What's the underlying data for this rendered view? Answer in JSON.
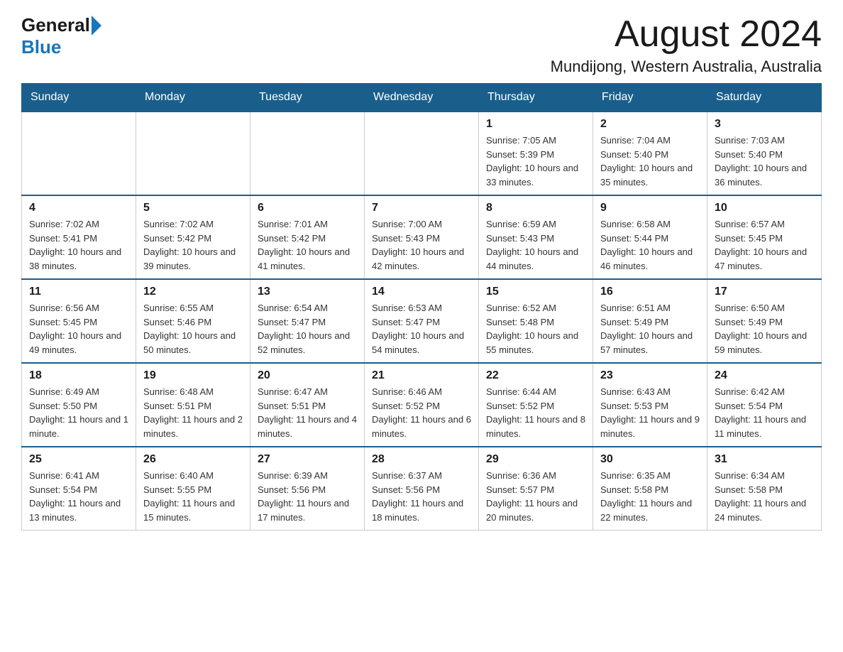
{
  "header": {
    "logo_general": "General",
    "logo_blue": "Blue",
    "month_title": "August 2024",
    "location": "Mundijong, Western Australia, Australia"
  },
  "weekdays": [
    "Sunday",
    "Monday",
    "Tuesday",
    "Wednesday",
    "Thursday",
    "Friday",
    "Saturday"
  ],
  "weeks": [
    [
      {
        "day": "",
        "info": ""
      },
      {
        "day": "",
        "info": ""
      },
      {
        "day": "",
        "info": ""
      },
      {
        "day": "",
        "info": ""
      },
      {
        "day": "1",
        "info": "Sunrise: 7:05 AM\nSunset: 5:39 PM\nDaylight: 10 hours and 33 minutes."
      },
      {
        "day": "2",
        "info": "Sunrise: 7:04 AM\nSunset: 5:40 PM\nDaylight: 10 hours and 35 minutes."
      },
      {
        "day": "3",
        "info": "Sunrise: 7:03 AM\nSunset: 5:40 PM\nDaylight: 10 hours and 36 minutes."
      }
    ],
    [
      {
        "day": "4",
        "info": "Sunrise: 7:02 AM\nSunset: 5:41 PM\nDaylight: 10 hours and 38 minutes."
      },
      {
        "day": "5",
        "info": "Sunrise: 7:02 AM\nSunset: 5:42 PM\nDaylight: 10 hours and 39 minutes."
      },
      {
        "day": "6",
        "info": "Sunrise: 7:01 AM\nSunset: 5:42 PM\nDaylight: 10 hours and 41 minutes."
      },
      {
        "day": "7",
        "info": "Sunrise: 7:00 AM\nSunset: 5:43 PM\nDaylight: 10 hours and 42 minutes."
      },
      {
        "day": "8",
        "info": "Sunrise: 6:59 AM\nSunset: 5:43 PM\nDaylight: 10 hours and 44 minutes."
      },
      {
        "day": "9",
        "info": "Sunrise: 6:58 AM\nSunset: 5:44 PM\nDaylight: 10 hours and 46 minutes."
      },
      {
        "day": "10",
        "info": "Sunrise: 6:57 AM\nSunset: 5:45 PM\nDaylight: 10 hours and 47 minutes."
      }
    ],
    [
      {
        "day": "11",
        "info": "Sunrise: 6:56 AM\nSunset: 5:45 PM\nDaylight: 10 hours and 49 minutes."
      },
      {
        "day": "12",
        "info": "Sunrise: 6:55 AM\nSunset: 5:46 PM\nDaylight: 10 hours and 50 minutes."
      },
      {
        "day": "13",
        "info": "Sunrise: 6:54 AM\nSunset: 5:47 PM\nDaylight: 10 hours and 52 minutes."
      },
      {
        "day": "14",
        "info": "Sunrise: 6:53 AM\nSunset: 5:47 PM\nDaylight: 10 hours and 54 minutes."
      },
      {
        "day": "15",
        "info": "Sunrise: 6:52 AM\nSunset: 5:48 PM\nDaylight: 10 hours and 55 minutes."
      },
      {
        "day": "16",
        "info": "Sunrise: 6:51 AM\nSunset: 5:49 PM\nDaylight: 10 hours and 57 minutes."
      },
      {
        "day": "17",
        "info": "Sunrise: 6:50 AM\nSunset: 5:49 PM\nDaylight: 10 hours and 59 minutes."
      }
    ],
    [
      {
        "day": "18",
        "info": "Sunrise: 6:49 AM\nSunset: 5:50 PM\nDaylight: 11 hours and 1 minute."
      },
      {
        "day": "19",
        "info": "Sunrise: 6:48 AM\nSunset: 5:51 PM\nDaylight: 11 hours and 2 minutes."
      },
      {
        "day": "20",
        "info": "Sunrise: 6:47 AM\nSunset: 5:51 PM\nDaylight: 11 hours and 4 minutes."
      },
      {
        "day": "21",
        "info": "Sunrise: 6:46 AM\nSunset: 5:52 PM\nDaylight: 11 hours and 6 minutes."
      },
      {
        "day": "22",
        "info": "Sunrise: 6:44 AM\nSunset: 5:52 PM\nDaylight: 11 hours and 8 minutes."
      },
      {
        "day": "23",
        "info": "Sunrise: 6:43 AM\nSunset: 5:53 PM\nDaylight: 11 hours and 9 minutes."
      },
      {
        "day": "24",
        "info": "Sunrise: 6:42 AM\nSunset: 5:54 PM\nDaylight: 11 hours and 11 minutes."
      }
    ],
    [
      {
        "day": "25",
        "info": "Sunrise: 6:41 AM\nSunset: 5:54 PM\nDaylight: 11 hours and 13 minutes."
      },
      {
        "day": "26",
        "info": "Sunrise: 6:40 AM\nSunset: 5:55 PM\nDaylight: 11 hours and 15 minutes."
      },
      {
        "day": "27",
        "info": "Sunrise: 6:39 AM\nSunset: 5:56 PM\nDaylight: 11 hours and 17 minutes."
      },
      {
        "day": "28",
        "info": "Sunrise: 6:37 AM\nSunset: 5:56 PM\nDaylight: 11 hours and 18 minutes."
      },
      {
        "day": "29",
        "info": "Sunrise: 6:36 AM\nSunset: 5:57 PM\nDaylight: 11 hours and 20 minutes."
      },
      {
        "day": "30",
        "info": "Sunrise: 6:35 AM\nSunset: 5:58 PM\nDaylight: 11 hours and 22 minutes."
      },
      {
        "day": "31",
        "info": "Sunrise: 6:34 AM\nSunset: 5:58 PM\nDaylight: 11 hours and 24 minutes."
      }
    ]
  ]
}
